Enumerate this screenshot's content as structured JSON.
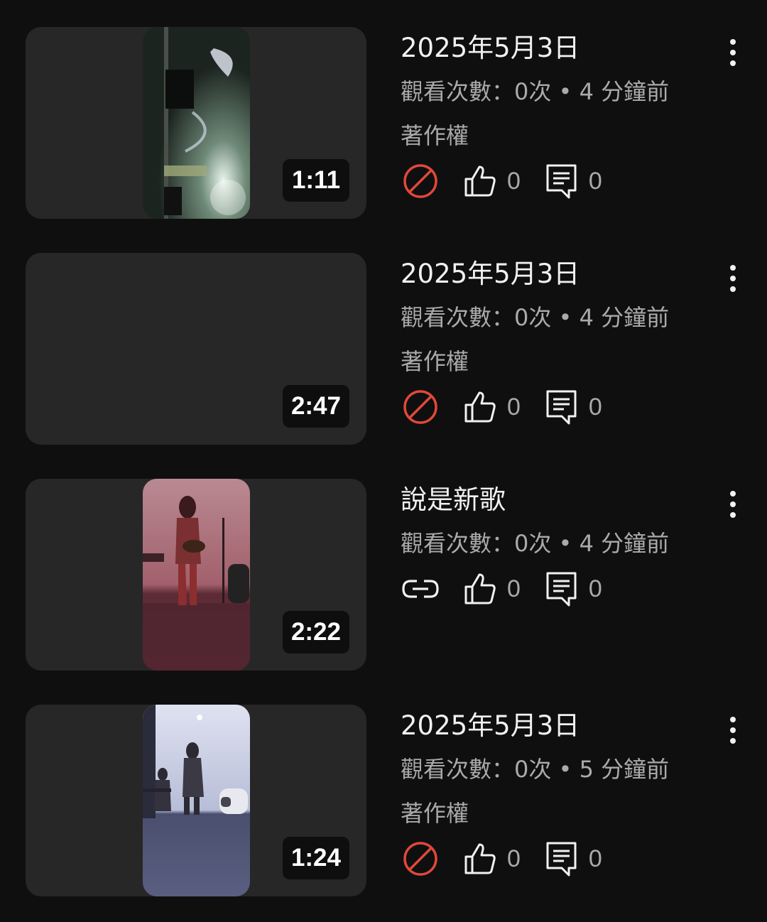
{
  "videos": [
    {
      "title": "2025年5月3日",
      "views": "觀看次數：0次 • 4 分鐘前",
      "status": "著作權",
      "status_icon": "blocked-icon",
      "duration": "1:11",
      "likes": "0",
      "comments": "0",
      "thumbnail": "concert-lights"
    },
    {
      "title": "2025年5月3日",
      "views": "觀看次數：0次 • 4 分鐘前",
      "status": "著作權",
      "status_icon": "blocked-icon",
      "duration": "2:47",
      "likes": "0",
      "comments": "0",
      "thumbnail": "none"
    },
    {
      "title": "說是新歌",
      "views": "觀看次數：0次 • 4 分鐘前",
      "status": "",
      "status_icon": "link-icon",
      "duration": "2:22",
      "likes": "0",
      "comments": "0",
      "thumbnail": "red-stage"
    },
    {
      "title": "2025年5月3日",
      "views": "觀看次數：0次 • 5 分鐘前",
      "status": "著作權",
      "status_icon": "blocked-icon",
      "duration": "1:24",
      "likes": "0",
      "comments": "0",
      "thumbnail": "blue-stage"
    }
  ],
  "colors": {
    "background": "#0f0f0f",
    "card": "#272727",
    "blocked": "#e0483a",
    "text_primary": "#f1f1f1",
    "text_secondary": "#aaaaaa"
  }
}
